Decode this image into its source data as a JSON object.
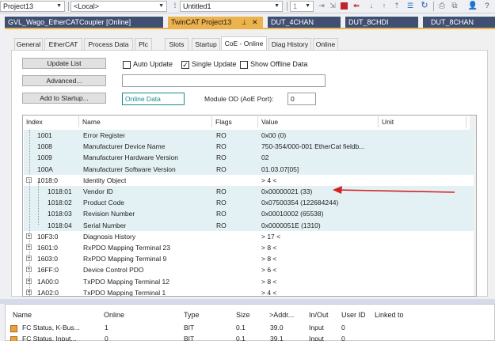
{
  "toolbar": {
    "project_combo": "Project13",
    "local_combo": "<Local>",
    "untitled_combo": "Untitled1",
    "counter_combo": "1",
    "colors": {
      "accent": "#ecb24c",
      "stop": "#c1222a",
      "blue": "#1e62b8"
    }
  },
  "document_tabs": [
    {
      "label": "GVL_Wago_EtherCATCoupler [Online]"
    },
    {
      "label": "TwinCAT Project13"
    },
    {
      "label": "DUT_4CHAN"
    },
    {
      "label": "DUT_8CHDI"
    },
    {
      "label": "DUT_8CHAN"
    }
  ],
  "tab_glyphs": {
    "pin": "⊣",
    "close": "✕"
  },
  "inner_tabs": [
    {
      "label": "General"
    },
    {
      "label": "EtherCAT"
    },
    {
      "label": "Process Data"
    },
    {
      "label": "Plc"
    },
    {
      "label": "Slots"
    },
    {
      "label": "Startup"
    },
    {
      "label": "CoE - Online"
    },
    {
      "label": "Diag History"
    },
    {
      "label": "Online"
    }
  ],
  "coe": {
    "update_list": "Update List",
    "advanced": "Advanced...",
    "add_to_startup": "Add to Startup...",
    "auto_update": "Auto Update",
    "single_update": "Single Update",
    "show_offline": "Show Offline Data",
    "online_data": "Online Data",
    "module_od_label": "Module OD (AoE Port):",
    "module_od_value": "0",
    "check_glyph": "✓",
    "columns": {
      "index": "Index",
      "name": "Name",
      "flags": "Flags",
      "value": "Value",
      "unit": "Unit"
    },
    "rows": [
      {
        "index": "1001",
        "name": "Error Register",
        "flags": "RO",
        "value": "0x00 (0)",
        "expander": "",
        "child": false
      },
      {
        "index": "1008",
        "name": "Manufacturer Device Name",
        "flags": "RO",
        "value": "750-354/000-001 EtherCat fieldb...",
        "expander": "",
        "child": false
      },
      {
        "index": "1009",
        "name": "Manufacturer Hardware Version",
        "flags": "RO",
        "value": "02",
        "expander": "",
        "child": false
      },
      {
        "index": "100A",
        "name": "Manufacturer Software Version",
        "flags": "RO",
        "value": "01.03.07[05]",
        "expander": "",
        "child": false
      },
      {
        "index": "1018:0",
        "name": "Identity Object",
        "flags": "",
        "value": "> 4 <",
        "expander": "−",
        "child": false
      },
      {
        "index": "1018:01",
        "name": "Vendor ID",
        "flags": "RO",
        "value": "0x00000021 (33)",
        "expander": "",
        "child": true
      },
      {
        "index": "1018:02",
        "name": "Product Code",
        "flags": "RO",
        "value": "0x07500354 (122684244)",
        "expander": "",
        "child": true
      },
      {
        "index": "1018:03",
        "name": "Revision Number",
        "flags": "RO",
        "value": "0x00010002 (65538)",
        "expander": "",
        "child": true
      },
      {
        "index": "1018:04",
        "name": "Serial Number",
        "flags": "RO",
        "value": "0x0000051E (1310)",
        "expander": "",
        "child": true
      },
      {
        "index": "10F3:0",
        "name": "Diagnosis History",
        "flags": "",
        "value": "> 17 <",
        "expander": "+",
        "child": false
      },
      {
        "index": "1601:0",
        "name": "RxPDO Mapping Terminal 23",
        "flags": "",
        "value": "> 8 <",
        "expander": "+",
        "child": false
      },
      {
        "index": "1603:0",
        "name": "RxPDO Mapping Terminal 9",
        "flags": "",
        "value": "> 8 <",
        "expander": "+",
        "child": false
      },
      {
        "index": "16FF:0",
        "name": "Device Control PDO",
        "flags": "",
        "value": "> 6 <",
        "expander": "+",
        "child": false
      },
      {
        "index": "1A00:0",
        "name": "TxPDO Mapping Terminal 12",
        "flags": "",
        "value": "> 8 <",
        "expander": "+",
        "child": false
      },
      {
        "index": "1A02:0",
        "name": "TxPDO Mapping Terminal 1",
        "flags": "",
        "value": "> 4 <",
        "expander": "+",
        "child": false
      }
    ]
  },
  "bottom": {
    "columns": {
      "name": "Name",
      "online": "Online",
      "type": "Type",
      "size": "Size",
      "addr": ">Addr...",
      "inout": "In/Out",
      "userid": "User ID",
      "linked": "Linked to"
    },
    "rows": [
      {
        "name": "FC Status, K-Bus...",
        "online": "1",
        "type": "BIT",
        "size": "0.1",
        "addr": "39.0",
        "inout": "Input",
        "userid": "0"
      },
      {
        "name": "FC Status, Input...",
        "online": "0",
        "type": "BIT",
        "size": "0.1",
        "addr": "39.1",
        "inout": "Input",
        "userid": "0"
      }
    ]
  }
}
